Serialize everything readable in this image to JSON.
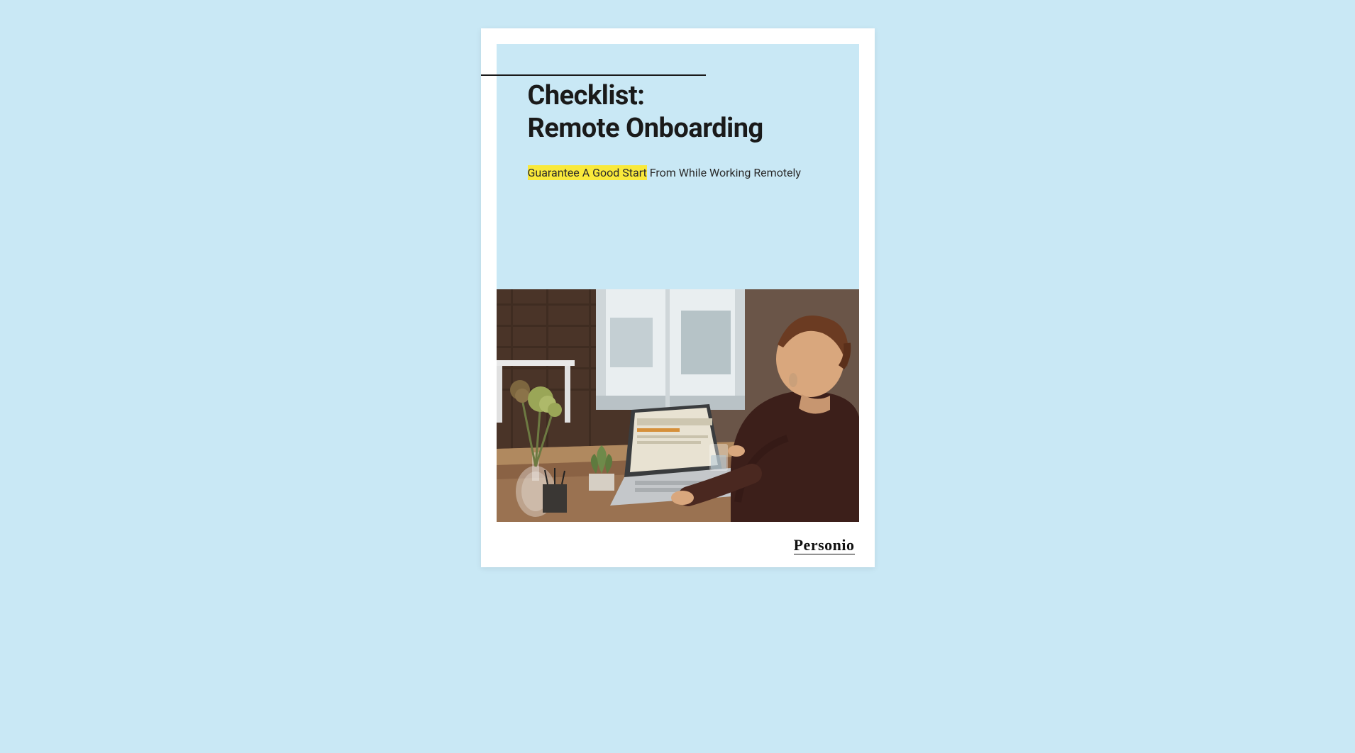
{
  "document": {
    "title_line1": "Checklist:",
    "title_line2": "Remote Onboarding",
    "subtitle_highlight": "Guarantee A Good Start",
    "subtitle_rest": " From While Working Remotely",
    "brand": "Personio",
    "hero_alt": "Person working on a laptop at a wooden desk near a window with plants"
  },
  "colors": {
    "page_bg": "#c9e8f5",
    "paper": "#ffffff",
    "text": "#1a1a1a",
    "highlight": "#f9e93b",
    "rule": "#1a1a1a"
  }
}
